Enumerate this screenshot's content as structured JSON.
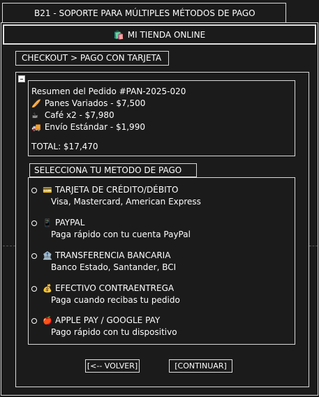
{
  "window": {
    "title": "B21 - SOPORTE PARA MÚLTIPLES MÉTODOS DE PAGO"
  },
  "store": {
    "icon": "store-icon",
    "emoji": "🛍️",
    "name": "MI TIENDA ONLINE"
  },
  "breadcrumb": "CHECKOUT > PAGO CON TARJETA",
  "order": {
    "title": "Resumen del Pedido #PAN-2025-020",
    "items": [
      {
        "icon": "bread-icon",
        "emoji": "🥖",
        "text": "Panes Variados - $7,500"
      },
      {
        "icon": "coffee-icon",
        "emoji": "☕",
        "text": "Café x2 - $7,980"
      },
      {
        "icon": "delivery-truck-icon",
        "emoji": "🚚",
        "text": "Envío Estándar - $1,990"
      }
    ],
    "total": "TOTAL: $17,470"
  },
  "payment": {
    "header": "SELECCIONA TU METODO DE PAGO",
    "options": [
      {
        "icon": "credit-card-icon",
        "emoji": "💳",
        "title": "TARJETA DE CRÉDITO/DÉBITO",
        "desc": "Visa, Mastercard, American Express"
      },
      {
        "icon": "mobile-phone-icon",
        "emoji": "📱",
        "title": "PAYPAL",
        "desc": "Paga rápido con tu cuenta PayPal"
      },
      {
        "icon": "bank-icon",
        "emoji": "🏦",
        "title": "TRANSFERENCIA BANCARIA",
        "desc": "Banco Estado, Santander, BCI"
      },
      {
        "icon": "money-bag-icon",
        "emoji": "💰",
        "title": "EFECTIVO CONTRAENTREGA",
        "desc": "Paga cuando recibas tu pedido"
      },
      {
        "icon": "apple-icon",
        "emoji": "🍎",
        "title": "APPLE PAY / GOOGLE PAY",
        "desc": "Pago rápido con tu dispositivo"
      }
    ]
  },
  "buttons": {
    "back": "[<-- VOLVER]",
    "continue": "[CONTINUAR]"
  },
  "colors": {
    "background": "#1b1b1b",
    "border": "#d9d9d9",
    "text": "#ffffff"
  }
}
